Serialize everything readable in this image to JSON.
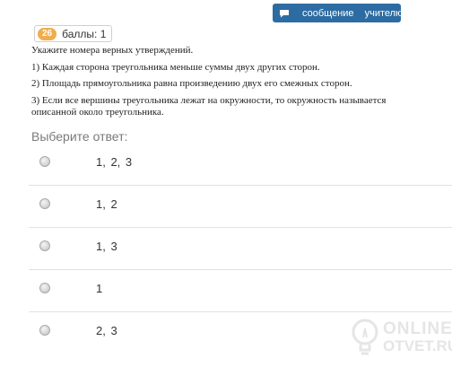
{
  "header": {
    "message_button_label": "сообщение учителю",
    "message_icon": "chat-bubble-icon",
    "question_number": "26",
    "points_label": "баллы: 1"
  },
  "question": {
    "prompt": "Укажите номера верных утверждений.",
    "statements": [
      "1) Каждая сторона треугольника меньше суммы двух других сторон.",
      "2) Площадь прямоугольника равна произведению двух его смежных сторон.",
      "3) Если все вершины треугольника лежат на окружности, то окружность называется описанной около треугольника."
    ]
  },
  "answer": {
    "choose_label": "Выберите ответ:",
    "options": [
      {
        "label": "1, 2, 3"
      },
      {
        "label": "1, 2"
      },
      {
        "label": "1, 3"
      },
      {
        "label": "1"
      },
      {
        "label": "2, 3"
      }
    ]
  },
  "watermark": {
    "line1": "ONLINE",
    "line2": "OTVET.RU",
    "icon": "lightbulb-icon"
  },
  "colors": {
    "message_button_bg": "#2d6ca2",
    "badge_bg": "#f0ad4e",
    "choose_label": "#7a7a7a"
  }
}
